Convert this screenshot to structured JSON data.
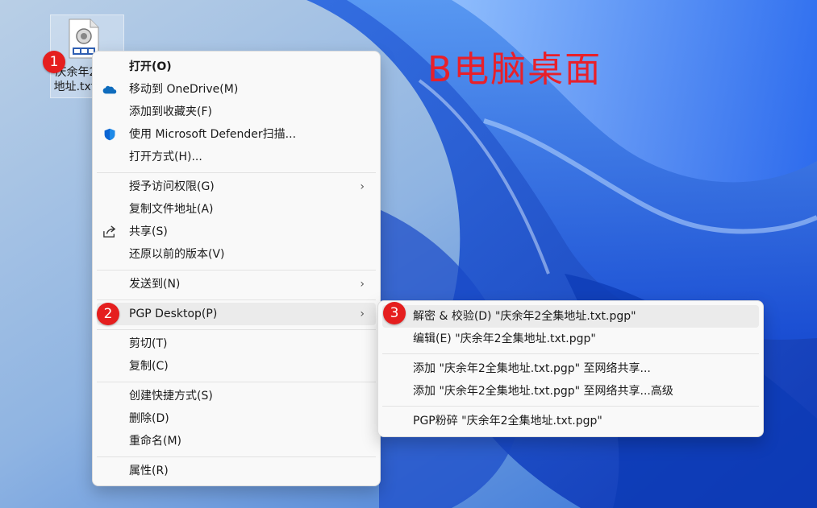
{
  "desktop": {
    "icon_label": "庆余年2全集\n地址.txt.pgp",
    "overlay_title": "B电脑桌面"
  },
  "badges": [
    "1",
    "2",
    "3"
  ],
  "context_menu": {
    "items": [
      "打开(O)",
      "移动到 OneDrive(M)",
      "添加到收藏夹(F)",
      "使用 Microsoft Defender扫描...",
      "打开方式(H)...",
      "授予访问权限(G)",
      "复制文件地址(A)",
      "共享(S)",
      "还原以前的版本(V)",
      "发送到(N)",
      "PGP Desktop(P)",
      "剪切(T)",
      "复制(C)",
      "创建快捷方式(S)",
      "删除(D)",
      "重命名(M)",
      "属性(R)"
    ],
    "submenu_arrow": "›"
  },
  "pgp_submenu": {
    "items": [
      "解密 & 校验(D) \"庆余年2全集地址.txt.pgp\"",
      "编辑(E) \"庆余年2全集地址.txt.pgp\"",
      "添加 \"庆余年2全集地址.txt.pgp\" 至网络共享...",
      "添加 \"庆余年2全集地址.txt.pgp\" 至网络共享...高级",
      "PGP粉碎 \"庆余年2全集地址.txt.pgp\""
    ]
  },
  "icons": {
    "onedrive": "cloud-icon",
    "defender": "shield-icon",
    "share": "share-icon",
    "file": "pgp-file-icon"
  },
  "colors": {
    "badge": "#e51e1e",
    "title_overlay": "#e8202a",
    "onedrive": "#0f6cbd",
    "defender": "#0a64d2"
  }
}
